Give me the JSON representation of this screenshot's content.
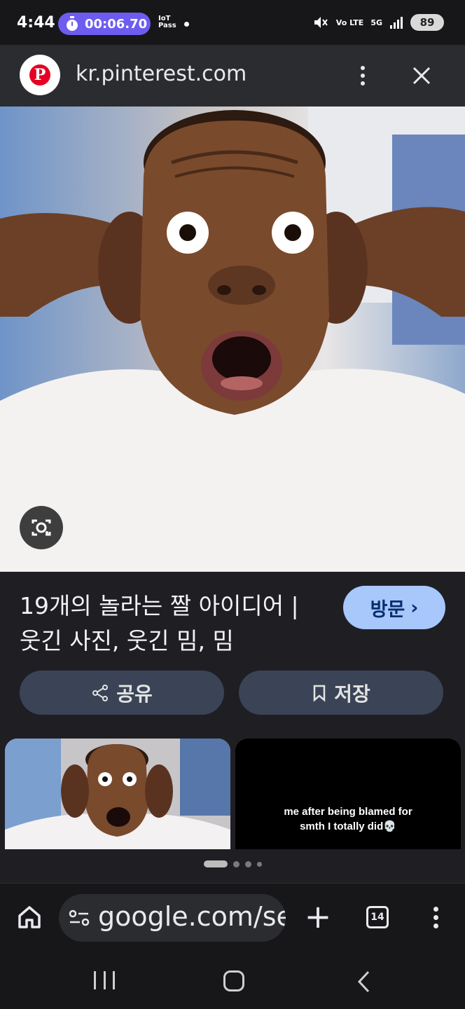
{
  "status_bar": {
    "time": "4:44",
    "timer": "00:06.70",
    "iot_label": "IoT\nPass",
    "network_label": "Vo LTE",
    "network_gen": "5G",
    "battery": "89"
  },
  "sheet": {
    "favicon_letter": "P",
    "url": "kr.pinterest.com"
  },
  "result": {
    "title_line1": "19개의 놀라는 짤 아이디어 |",
    "title_line2": "웃긴 사진, 웃긴 밈, 밈",
    "visit_label": "방문",
    "visit_chevron": "›",
    "share_label": "공유",
    "save_label": "저장",
    "thumb2_caption_line1": "me after being blamed for",
    "thumb2_caption_line2": "smth I totally did💀"
  },
  "toolbar": {
    "omnibox_text": "google.com/se",
    "plus": "+",
    "tab_count": "14"
  },
  "colors": {
    "timer_pill": "#6e5cf0",
    "visit_button": "#a8c7fa",
    "pill_button": "#3a4456",
    "pinterest_red": "#e60023"
  }
}
